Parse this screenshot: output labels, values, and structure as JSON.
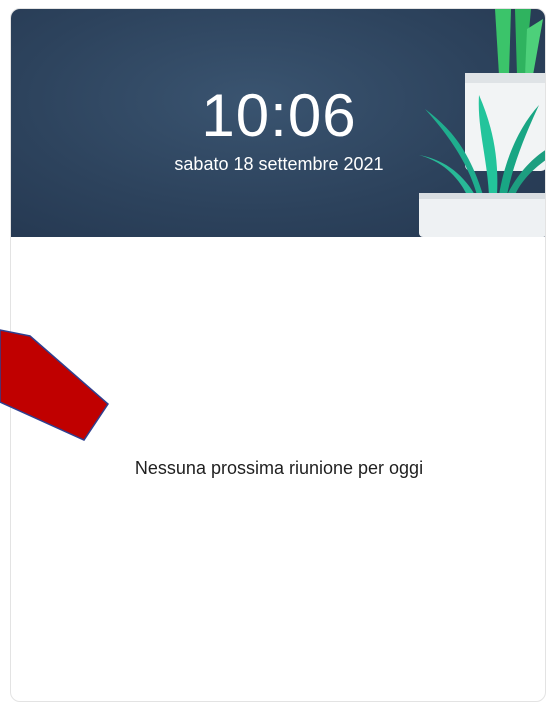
{
  "widget": {
    "time": "10:06",
    "date": "sabato 18 settembre 2021",
    "empty_message": "Nessuna prossima riunione per oggi"
  },
  "colors": {
    "header_background": "#2d435d",
    "text_on_header": "#ffffff",
    "body_text": "#1f1f1f",
    "annotation_arrow_fill": "#c00000",
    "annotation_arrow_stroke": "#2f3f8f"
  },
  "icons": {
    "header_art": "potted-plant-illustration",
    "annotation": "red-arrow"
  }
}
